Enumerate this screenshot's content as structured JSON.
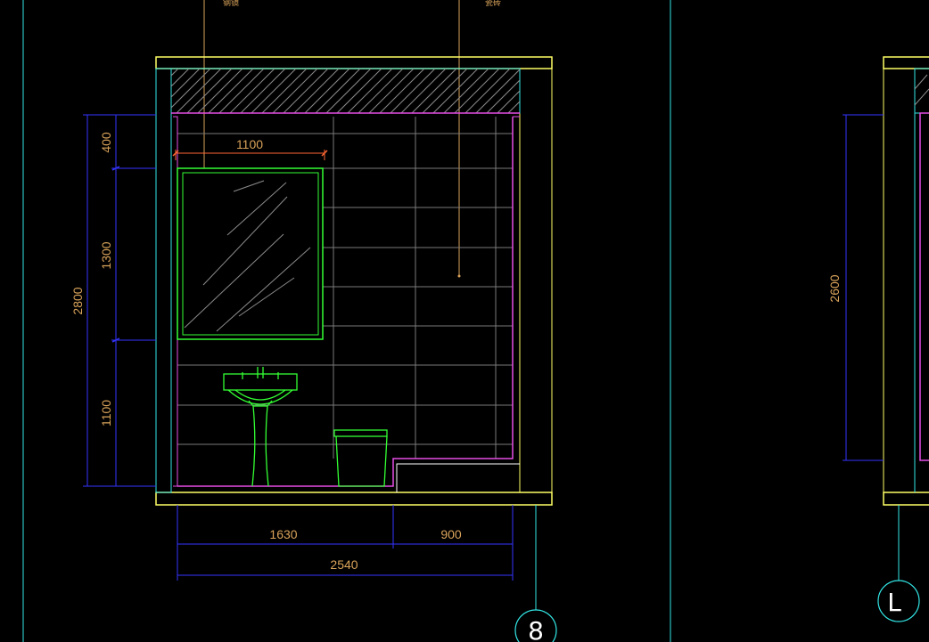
{
  "drawing": {
    "colors": {
      "background": "#000000",
      "wall": "#ffff66",
      "cyan": "#33e6e6",
      "magenta": "#e64de6",
      "green": "#33ff33",
      "tile": "#8c8c8c",
      "dimension": "#3333ff",
      "dimension_text": "#d9a35a",
      "leader": "#d9a35a",
      "mirror_dim": "#ff6633"
    },
    "vertical_dimensions": {
      "segments": [
        "400",
        "1300",
        "1100"
      ],
      "total": "2800"
    },
    "mirror_width": "1100",
    "horizontal_dimensions": {
      "segments": [
        "1630",
        "900"
      ],
      "total": "2540"
    },
    "right_view": {
      "height_dimension": "2600"
    },
    "top_labels": [
      "钢镜",
      "瓷砖"
    ],
    "section_bubbles": [
      "8",
      "L"
    ]
  }
}
